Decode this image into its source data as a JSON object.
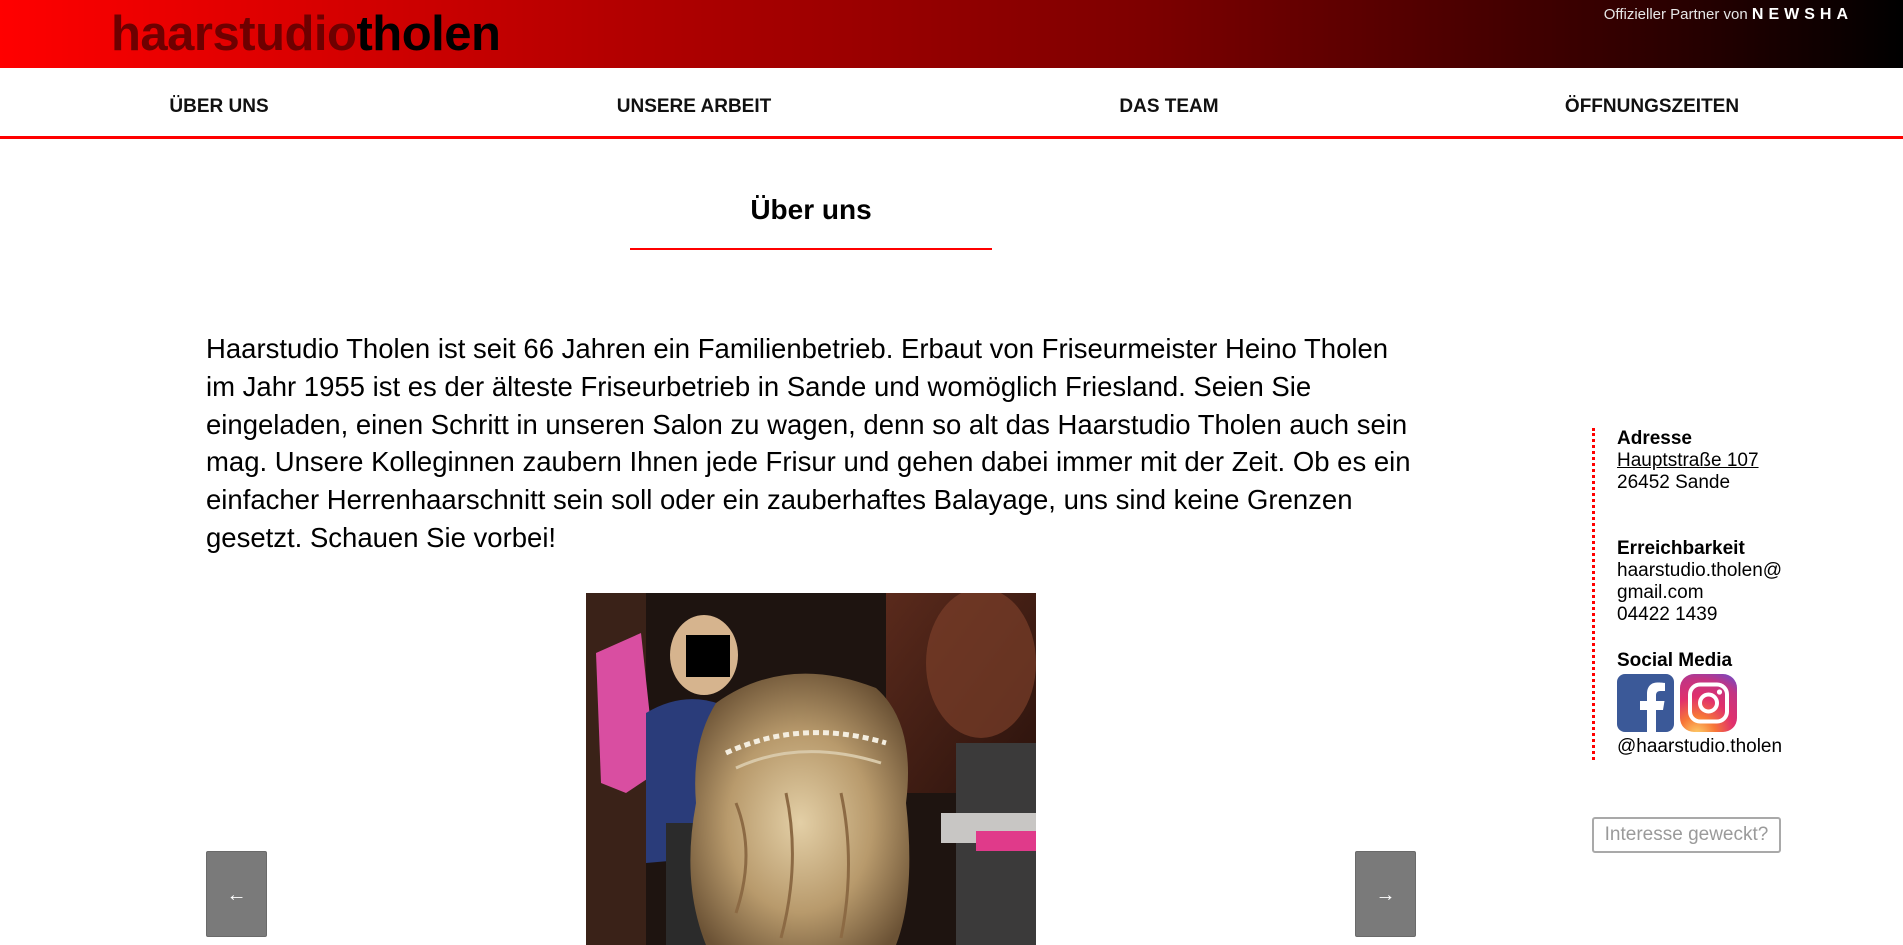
{
  "header": {
    "logo_part1": "haarstudio",
    "logo_part2": "tholen",
    "partner_prefix": "Offizieller Partner von",
    "partner_brand": "NEWSHA"
  },
  "nav": {
    "items": [
      {
        "label": "ÜBER UNS"
      },
      {
        "label": "UNSERE ARBEIT"
      },
      {
        "label": "DAS TEAM"
      },
      {
        "label": "ÖFFNUNGSZEITEN"
      }
    ]
  },
  "main": {
    "title": "Über uns",
    "intro": "Haarstudio Tholen ist seit 66 Jahren ein Familienbetrieb. Erbaut von Friseurmeister Heino Tholen im Jahr 1955 ist es der älteste Friseurbetrieb in Sande und womöglich Friesland. Seien Sie eingeladen, einen Schritt in unseren Salon zu wagen, denn so alt das Haarstudio Tholen auch sein mag. Unsere Kolleginnen zaubern Ihnen jede Frisur und gehen dabei immer mit der Zeit. Ob es ein einfacher Herrenhaarschnitt sein soll oder ein zauberhaftes Balayage, uns sind keine Grenzen gesetzt. Schauen Sie vorbei!"
  },
  "slider": {
    "prev_icon": "arrow-left-icon",
    "next_icon": "arrow-right-icon",
    "prev_glyph": "←",
    "next_glyph": "→"
  },
  "sidebar": {
    "address_heading": "Adresse",
    "address_street": "Hauptstraße 107",
    "address_city": "26452 Sande",
    "contact_heading": "Erreichbarkeit",
    "email_line1": "haarstudio.tholen@",
    "email_line2": "gmail.com",
    "phone": "04422 1439",
    "social_heading": "Social Media",
    "social_icons": [
      "facebook-icon",
      "instagram-icon"
    ],
    "social_handle": "@haarstudio.tholen"
  },
  "cta": {
    "label": "Interesse geweckt?"
  },
  "colors": {
    "accent": "#ff0000",
    "header_dark": "#000000",
    "facebook": "#3b5998",
    "button_gray": "#7a7a7a"
  }
}
